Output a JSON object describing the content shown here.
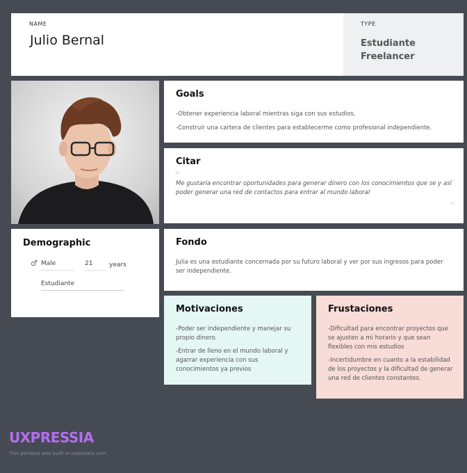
{
  "header": {
    "name_label": "NAME",
    "name": "Julio Bernal",
    "type_label": "TYPE",
    "type_value": "Estudiante Freelancer"
  },
  "goals": {
    "title": "Goals",
    "items": [
      "-Obtener experiencia laboral mientras siga con sus estudios.",
      "-Construir una cartera de clientes para establecerme como profesional independiente."
    ]
  },
  "quote": {
    "title": "Citar",
    "text": "Me gustaría encontrar oportunidades para generar dinero con los conocimientos que se y así poder generar una red de contactos para entrar al mundo laboral"
  },
  "demographic": {
    "title": "Demographic",
    "gender": "Male",
    "age": "21",
    "age_unit": "years",
    "occupation": "Estudiante"
  },
  "background": {
    "title": "Fondo",
    "text": "Julia es una estudiante concernada por su futuro laboral y ver por sus ingresos para poder ser independiente."
  },
  "motivations": {
    "title": "Motivaciones",
    "items": [
      "-Poder ser independiente y manejar su propio dinero.",
      "-Entrar de lleno en el mundo laboral y agarrar experiencia con sus conocimientos ya previos"
    ]
  },
  "frustrations": {
    "title": "Frustaciones",
    "items": [
      "-Dificultad para encontrar proyectos que se ajusten a  mi horario y que sean flexibles con mis estudios",
      "-Incertidumbre en cuanto a la estabilidad de los proyectos y la dificultad de generar una red de clientes constantes."
    ]
  },
  "footer": {
    "brand": "UXPRESSIA",
    "note": "This persona was built in uxpressia.com"
  },
  "icons": {
    "gender": "male-symbol-icon",
    "quote_open": "quote-open-icon",
    "quote_close": "quote-close-icon"
  },
  "colors": {
    "background": "#464b53",
    "motivations_bg": "#e4f7f2",
    "frustrations_bg": "#f8dcd8",
    "brand": "#b36ef0"
  }
}
